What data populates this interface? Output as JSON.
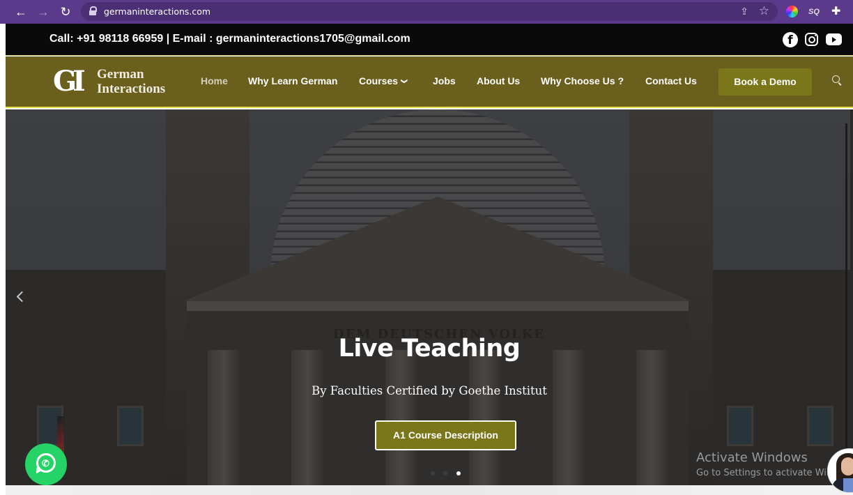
{
  "browser": {
    "url": "germaninteractions.com",
    "nav_icons": [
      "back-arrow-icon",
      "forward-arrow-icon",
      "reload-icon"
    ],
    "omnibox_icons": [
      "lock-icon",
      "share-icon",
      "bookmark-star-icon"
    ],
    "extensions": [
      "color-wheel-extension-icon",
      "sq-extension-icon",
      "puzzle-extensions-icon"
    ],
    "back_glyph": "←",
    "forward_glyph": "→",
    "reload_glyph": "↻",
    "share_glyph": "⇪",
    "star_glyph": "☆",
    "sq_label": "SQ",
    "puzzle_glyph": "✚"
  },
  "topbar": {
    "contact_text": "Call: +91 98118 66959 | E-mail : germaninteractions1705@gmail.com",
    "social": [
      {
        "name": "facebook-icon",
        "glyph": "f"
      },
      {
        "name": "instagram-icon",
        "glyph": ""
      },
      {
        "name": "youtube-icon",
        "glyph": ""
      }
    ]
  },
  "header": {
    "logo_mark": "GI",
    "logo_line1": "German",
    "logo_line2": "Interactions",
    "menu": [
      {
        "label": "Home",
        "active": true
      },
      {
        "label": "Why Learn German"
      },
      {
        "label": "Courses",
        "has_dropdown": true
      },
      {
        "label": "Jobs"
      },
      {
        "label": "About Us"
      },
      {
        "label": "Why Choose Us ?"
      },
      {
        "label": "Contact Us"
      }
    ],
    "chevron_glyph": "❯",
    "cta_label": "Book a Demo",
    "brand_color": "#6b5f1d",
    "accent_color": "#7b761a",
    "border_color": "#e8e24a"
  },
  "hero": {
    "inscription": "DEM DEUTSCHEN VOLKE",
    "title": "Live Teaching",
    "subtitle": "By Faculties Certified by Goethe Institut",
    "button_label": "A1 Course Description",
    "slides_total": 3,
    "active_slide": 3
  },
  "overlay": {
    "activate_title": "Activate Windows",
    "activate_sub": "Go to Settings to activate Windows.",
    "whatsapp_glyph": "✆",
    "whatsapp_color": "#25d366"
  }
}
